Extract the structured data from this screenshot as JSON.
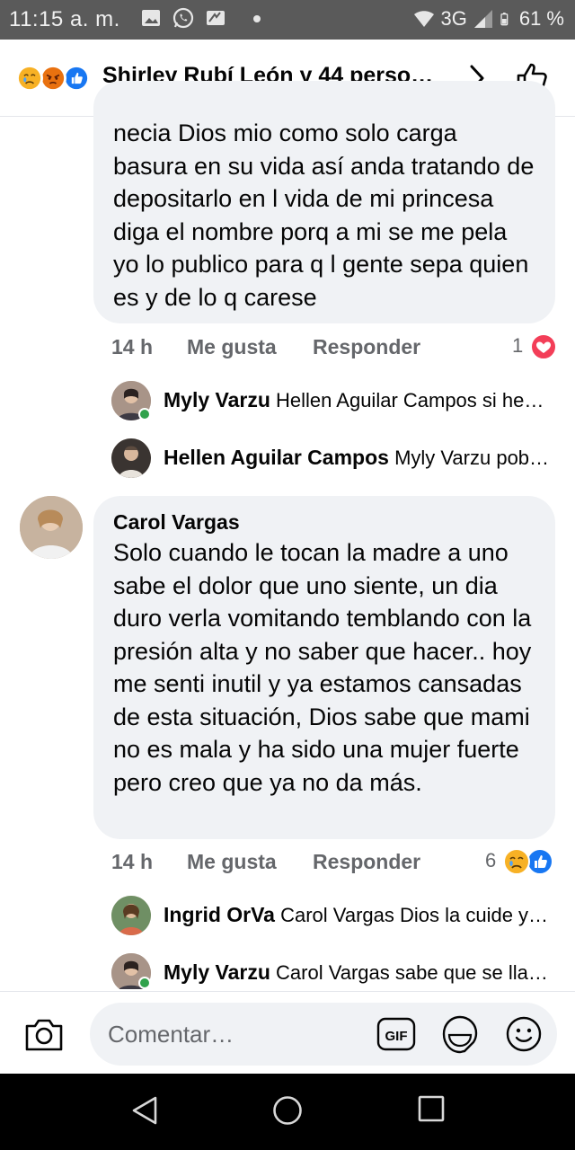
{
  "status_bar": {
    "time": "11:15 a. m.",
    "network": "3G",
    "battery": "61 %"
  },
  "header": {
    "title": "Shirley Rubí León y 44 perso…",
    "reactions": [
      "sad-reaction",
      "angry-reaction",
      "like-reaction"
    ]
  },
  "comments": [
    {
      "text": "necia Dios mio como solo carga basura en su vida así anda tratando de depositarlo en l vida de mi princesa diga el nombre porq a mi se me pela yo lo publico para q l gente sepa quien es y de lo q carese",
      "time": "14 h",
      "like_label": "Me gusta",
      "reply_label": "Responder",
      "reaction_count": "1",
      "replies": [
        {
          "name": "Myly Varzu",
          "preview": "Hellen Aguilar Campos si he…"
        },
        {
          "name": "Hellen Aguilar Campos",
          "preview": "Myly Varzu pob…"
        }
      ]
    },
    {
      "author": "Carol Vargas",
      "text": "Solo cuando le tocan la madre a uno sabe el dolor que uno siente, un dia duro verla vomitando temblando con la presión alta y no saber que hacer.. hoy me senti inutil y ya estamos cansadas de esta situación, Dios sabe que mami no es mala y ha sido una mujer fuerte pero creo que ya no da más.",
      "time": "14 h",
      "like_label": "Me gusta",
      "reply_label": "Responder",
      "reaction_count": "6",
      "replies": [
        {
          "name": "Ingrid OrVa",
          "preview": "Carol Vargas Dios la cuide y…"
        },
        {
          "name": "Myly Varzu",
          "preview": "Carol Vargas sabe que se lla…"
        }
      ]
    }
  ],
  "composer": {
    "placeholder": "Comentar…"
  },
  "colors": {
    "bubble": "#f0f2f5",
    "meta_text": "#65676b",
    "facebook_blue": "#1877f2",
    "love_red": "#f33e58",
    "sad_yellow": "#f7b125",
    "angry_orange": "#e9710f",
    "online_green": "#31a24c"
  }
}
